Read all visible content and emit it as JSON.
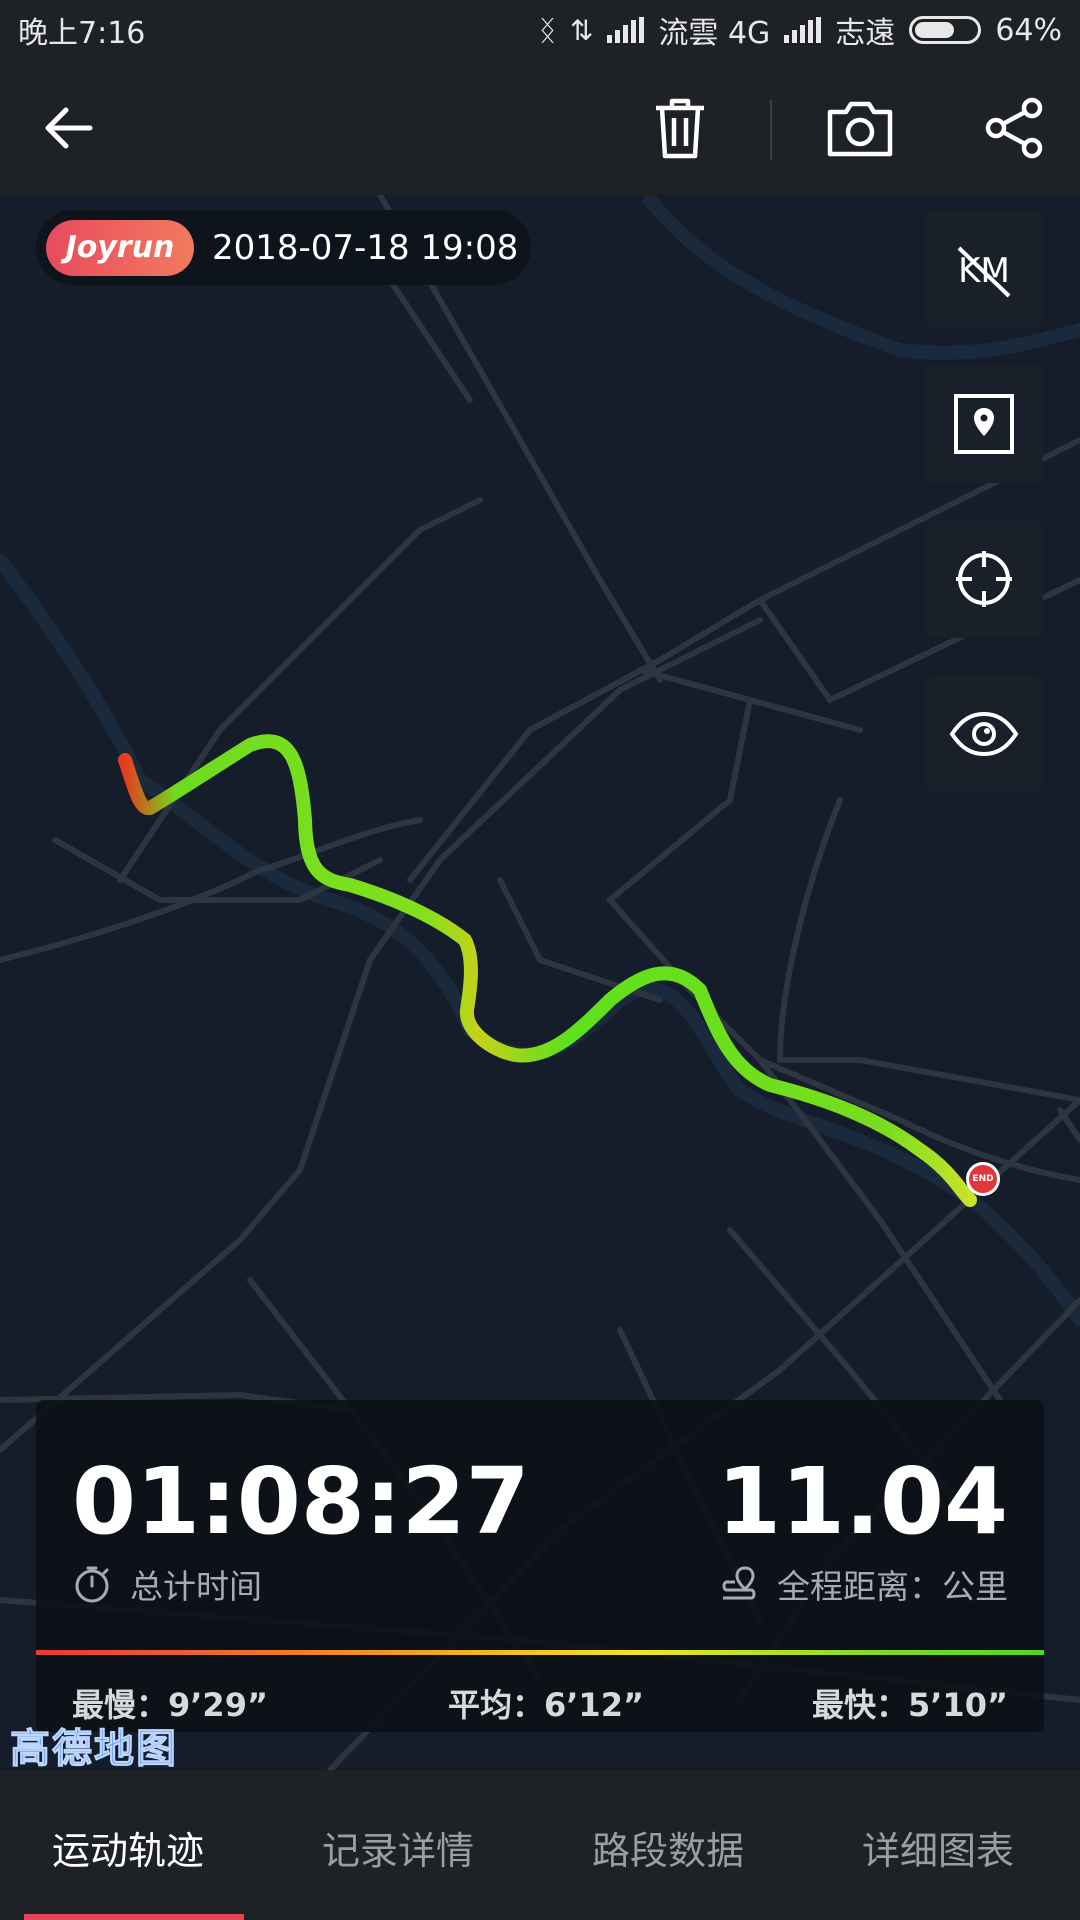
{
  "status_bar": {
    "time": "晚上7:16",
    "carrier1": "流雲 4G",
    "carrier2": "志遠",
    "battery": "64%",
    "battery_level": 0.64
  },
  "toolbar": {
    "back_icon": "arrow-left-icon",
    "delete_icon": "trash-icon",
    "camera_icon": "camera-icon",
    "share_icon": "share-icon"
  },
  "map": {
    "brand": "Joyrun",
    "datetime": "2018-07-18 19:08",
    "km_toggle_label": "KM",
    "end_label": "END",
    "provider": "高德地图",
    "colors": {
      "background": "#141d29",
      "road": "#2c3540",
      "river": "#1a2a3c",
      "end_marker": "#e2363b"
    }
  },
  "stats": {
    "duration": "01:08:27",
    "duration_label": "总计时间",
    "distance": "11.04",
    "distance_label": "全程距离：公里",
    "slowest": "最慢：9’29”",
    "average": "平均：6’12”",
    "fastest": "最快：5’10”"
  },
  "tabs": [
    {
      "label": "运动轨迹",
      "active": true
    },
    {
      "label": "记录详情",
      "active": false
    },
    {
      "label": "路段数据",
      "active": false
    },
    {
      "label": "详细图表",
      "active": false
    }
  ],
  "accent_color": "#e64356"
}
